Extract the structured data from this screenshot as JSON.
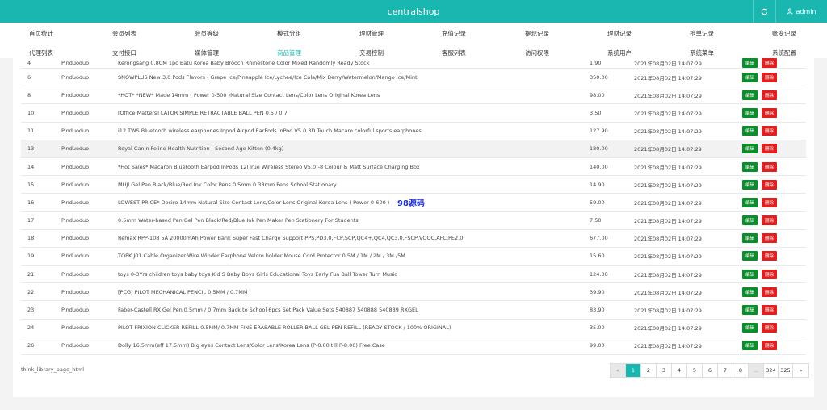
{
  "app": {
    "title": "centralshop",
    "user": "admin"
  },
  "nav": {
    "row1": [
      "首页统计",
      "会员列表",
      "会员等级",
      "模式分组",
      "理财管理",
      "充值记录",
      "提现记录",
      "理财记录",
      "抢单记录",
      "账变记录"
    ],
    "row2": [
      "代理列表",
      "支付接口",
      "媒体管理",
      "商品管理",
      "交易控制",
      "客服列表",
      "访问权限",
      "系统用户",
      "系统菜单",
      "系统配置"
    ]
  },
  "table": {
    "edit_label": "编辑",
    "delete_label": "删除",
    "rows": [
      {
        "id": "4",
        "source": "Pinduoduo",
        "name": "Kerongsang 0.8CM 1pc Batu Korea Baby Brooch Rhinestone Color Mixed Randomly Ready Stock",
        "price": "1.90",
        "time": "2021年08月02日 14:07:29"
      },
      {
        "id": "6",
        "source": "Pinduoduo",
        "name": "SNOWPLUS New 3.0 Pods Flavors - Grape Ice/Pineapple Ice/Lychee/Ice Cola/Mix Berry/Watermelon/Mango Ice/Mint",
        "price": "350.00",
        "time": "2021年08月02日 14:07:29"
      },
      {
        "id": "8",
        "source": "Pinduoduo",
        "name": "*HOT* *NEW* Made 14mm ( Power 0-500 )Natural Size Contact Lens/Color Lens Original Korea Lens",
        "price": "98.00",
        "time": "2021年08月02日 14:07:29"
      },
      {
        "id": "10",
        "source": "Pinduoduo",
        "name": "[Office Matters] LATOR SIMPLE RETRACTABLE BALL PEN 0.5 / 0.7",
        "price": "3.50",
        "time": "2021年08月02日 14:07:29"
      },
      {
        "id": "11",
        "source": "Pinduoduo",
        "name": "i12 TWS Bluetooth wireless earphones Inpod Airpod EarPods inPod V5.0 3D Touch Macaro colorful sports earphones",
        "price": "127.90",
        "time": "2021年08月02日 14:07:29"
      },
      {
        "id": "13",
        "source": "Pinduoduo",
        "name": "Royal Canin Feline Health Nutrition - Second Age Kitten (0.4kg)",
        "price": "180.00",
        "time": "2021年08月02日 14:07:29"
      },
      {
        "id": "14",
        "source": "Pinduoduo",
        "name": "*Hot Sales* Macaron Bluetooth Earpod InPods 12(True Wireless Stereo V5.0)-8 Colour & Matt Surface Charging Box",
        "price": "140.00",
        "time": "2021年08月02日 14:07:29"
      },
      {
        "id": "15",
        "source": "Pinduoduo",
        "name": "MUJI Gel Pen Black/Blue/Red Ink Color Pens 0.5mm 0.38mm Pens School Stationary",
        "price": "14.90",
        "time": "2021年08月02日 14:07:29"
      },
      {
        "id": "16",
        "source": "Pinduoduo",
        "name": "LOWEST PRICE* Desire 14mm Natural Size Contact Lens/Color Lens Original Korea Lens ( Power 0-600 )",
        "price": "59.00",
        "time": "2021年08月02日 14:07:29"
      },
      {
        "id": "17",
        "source": "Pinduoduo",
        "name": "0.5mm Water-based Pen Gel Pen Black/Red/Blue Ink Pen Maker Pen Stationery For Students",
        "price": "7.50",
        "time": "2021年08月02日 14:07:29"
      },
      {
        "id": "18",
        "source": "Pinduoduo",
        "name": "Remax RPP-108 5A 20000mAh Power Bank Super Fast Charge Support PPS,PD3.0,FCP,SCP,QC4+,QC4,QC3.0,FSCP,VOOC,AFC,PE2.0",
        "price": "677.00",
        "time": "2021年08月02日 14:07:29"
      },
      {
        "id": "19",
        "source": "Pinduoduo",
        "name": "TOPK J01 Cable Organizer Wire Winder Earphone Velcro holder Mouse Cord Protector 0.5M / 1M / 2M / 3M /5M",
        "price": "15.60",
        "time": "2021年08月02日 14:07:29"
      },
      {
        "id": "21",
        "source": "Pinduoduo",
        "name": "toys 0-3Yrs children toys baby toys Kid S Baby Boys Girls Educational Toys Early Fun Ball Tower Turn Music",
        "price": "124.00",
        "time": "2021年08月02日 14:07:29"
      },
      {
        "id": "22",
        "source": "Pinduoduo",
        "name": "[PCG] PILOT MECHANICAL PENCIL 0.5MM / 0.7MM",
        "price": "39.90",
        "time": "2021年08月02日 14:07:29"
      },
      {
        "id": "23",
        "source": "Pinduoduo",
        "name": "Faber-Castell RX Gel Pen 0.5mm / 0.7mm Back to School 6pcs Set Pack Value Sets 540887 540888 540889 RXGEL",
        "price": "83.90",
        "time": "2021年08月02日 14:07:29"
      },
      {
        "id": "24",
        "source": "Pinduoduo",
        "name": "PILOT FRIXION CLICKER REFILL 0.5MM/ 0.7MM FINE ERASABLE ROLLER BALL GEL PEN REFILL (READY STOCK / 100% ORIGINAL)",
        "price": "35.00",
        "time": "2021年08月02日 14:07:29"
      },
      {
        "id": "26",
        "source": "Pinduoduo",
        "name": "Dolly 16.5mm(eff 17.5mm) Big eyes Contact Lens/Color Lens/Korea Lens (P-0.00 till P-8.00) Free Case",
        "price": "99.00",
        "time": "2021年08月02日 14:07:29"
      }
    ]
  },
  "watermark": "98源码",
  "footer": {
    "text": "think_library_page_html"
  },
  "pagination": {
    "prev": "«",
    "next": "»",
    "pages": [
      "1",
      "2",
      "3",
      "4",
      "5",
      "6",
      "7",
      "8"
    ],
    "ellipsis": "...",
    "tail": [
      "324",
      "325"
    ],
    "active": "1"
  }
}
